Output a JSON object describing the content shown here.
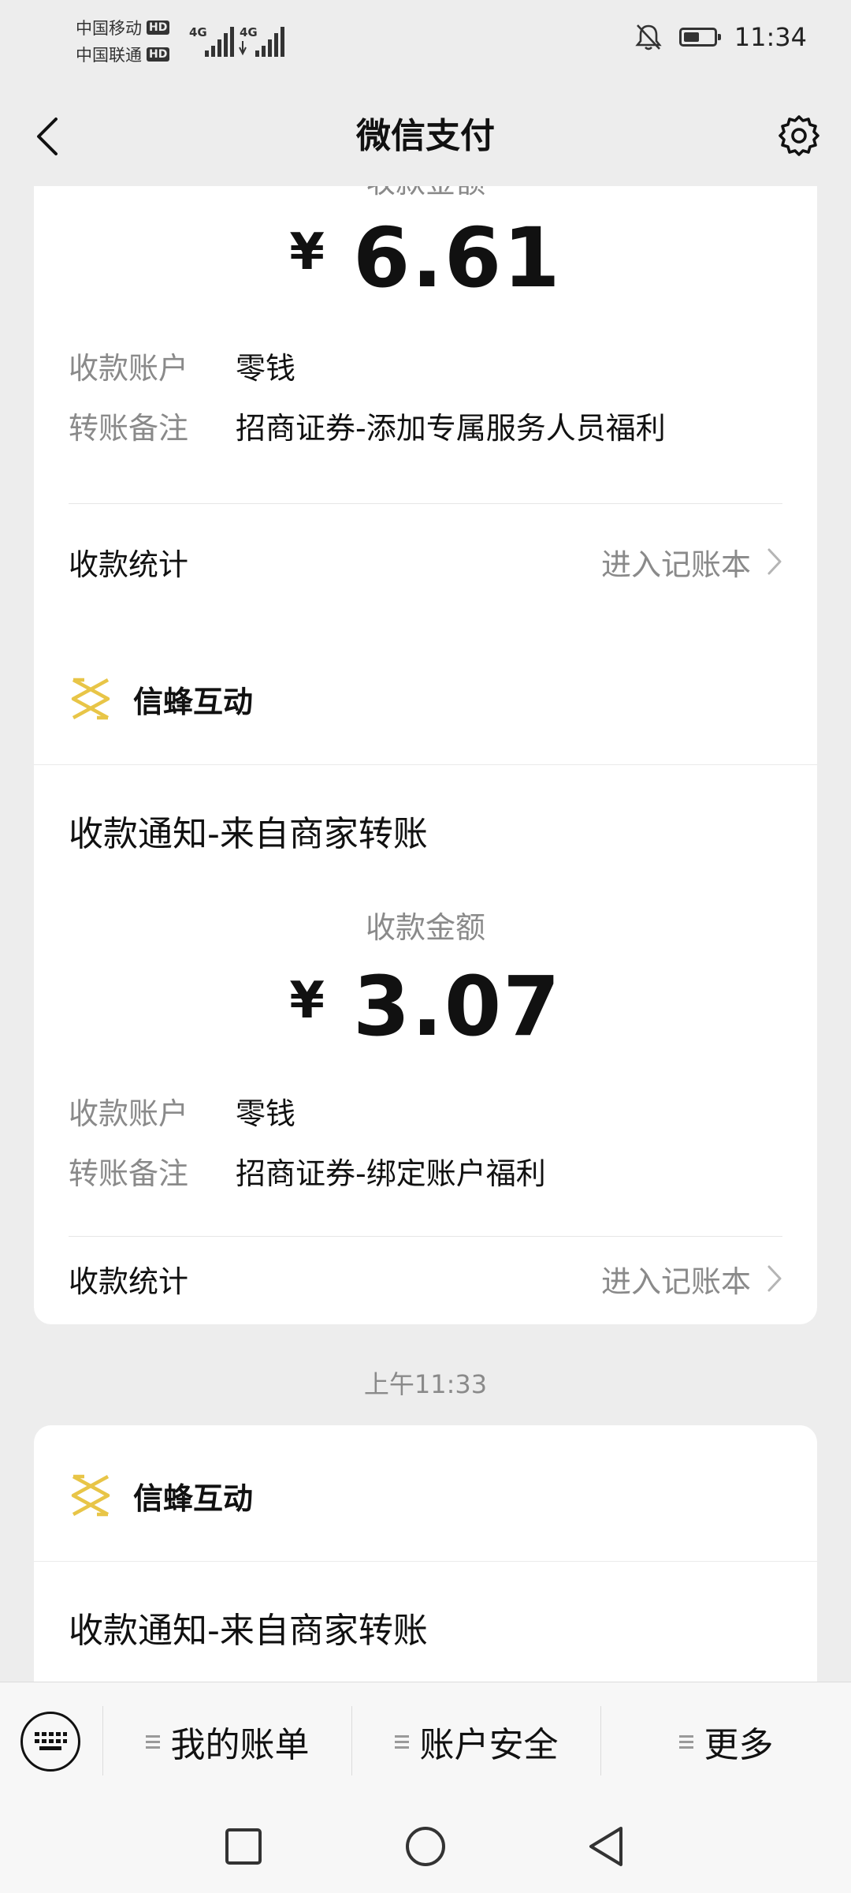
{
  "status_bar": {
    "carrier_1": "中国移动",
    "carrier_2": "中国联通",
    "hd": "HD",
    "network": "4G",
    "time": "11:34"
  },
  "navbar": {
    "title": "微信支付"
  },
  "cards": [
    {
      "amount_label": "收款金额",
      "currency": "¥",
      "amount": "6.61",
      "account_key": "收款账户",
      "account_val": "零钱",
      "note_key": "转账备注",
      "note_val": "招商证券-添加专属服务人员福利",
      "stats_label": "收款统计",
      "stats_link": "进入记账本"
    },
    {
      "merchant": "信蜂互动",
      "notice_title": "收款通知-来自商家转账",
      "amount_label": "收款金额",
      "currency": "¥",
      "amount": "3.07",
      "account_key": "收款账户",
      "account_val": "零钱",
      "note_key": "转账备注",
      "note_val": "招商证券-绑定账户福利",
      "stats_label": "收款统计",
      "stats_link": "进入记账本"
    },
    {
      "merchant": "信蜂互动",
      "notice_title": "收款通知-来自商家转账"
    }
  ],
  "timestamp": "上午11:33",
  "bottom_menu": {
    "bills": "我的账单",
    "security": "账户安全",
    "more": "更多"
  },
  "colors": {
    "background": "#ededed",
    "card": "#ffffff",
    "logo_yellow": "#e8c547",
    "muted_text": "#8a8a8a"
  }
}
